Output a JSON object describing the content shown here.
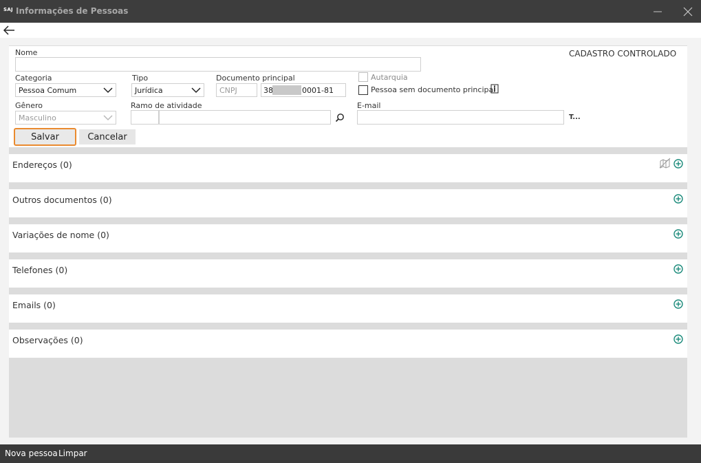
{
  "window": {
    "logo_text": "SAJ",
    "title": "Informações de Pessoas"
  },
  "form": {
    "status_label": "CADASTRO CONTROLADO",
    "nome": {
      "label": "Nome",
      "value": ""
    },
    "categoria": {
      "label": "Categoria",
      "value": "Pessoa Comum"
    },
    "tipo": {
      "label": "Tipo",
      "value": "Jurídica"
    },
    "documento": {
      "label": "Documento principal",
      "type_value": "CNPJ",
      "number_prefix": "38.",
      "number_suffix": "0001-81"
    },
    "autarquia": {
      "label": "Autarquia",
      "checked": false
    },
    "sem_documento": {
      "label": "Pessoa sem documento principal",
      "checked": false
    },
    "genero": {
      "label": "Gênero",
      "value": "Masculino"
    },
    "ramo": {
      "label": "Ramo de atividade",
      "code": "",
      "value": ""
    },
    "email": {
      "label": "E-mail",
      "value": "",
      "trailing_text": "T..."
    },
    "save_label": "Salvar",
    "cancel_label": "Cancelar"
  },
  "sections": [
    {
      "title": "Endereços (0)",
      "has_map": true
    },
    {
      "title": "Outros documentos (0)",
      "has_map": false
    },
    {
      "title": "Variações de nome (0)",
      "has_map": false
    },
    {
      "title": "Telefones (0)",
      "has_map": false
    },
    {
      "title": "Emails (0)",
      "has_map": false
    },
    {
      "title": "Observações (0)",
      "has_map": false
    }
  ],
  "footer": {
    "new_person": "Nova pessoa",
    "clear": "Limpar"
  },
  "colors": {
    "accent_orange": "#ea8a2e",
    "add_icon_teal": "#1a8a7a",
    "titlebar": "#3d3d3d",
    "footer": "#3a3a3a"
  },
  "icons": {
    "minimize": "minimize-icon",
    "close": "close-icon",
    "back": "back-arrow-icon",
    "chevron": "chevron-down-icon",
    "search": "search-icon",
    "info": "info-icon",
    "map": "map-icon",
    "add": "plus-circle-icon"
  }
}
